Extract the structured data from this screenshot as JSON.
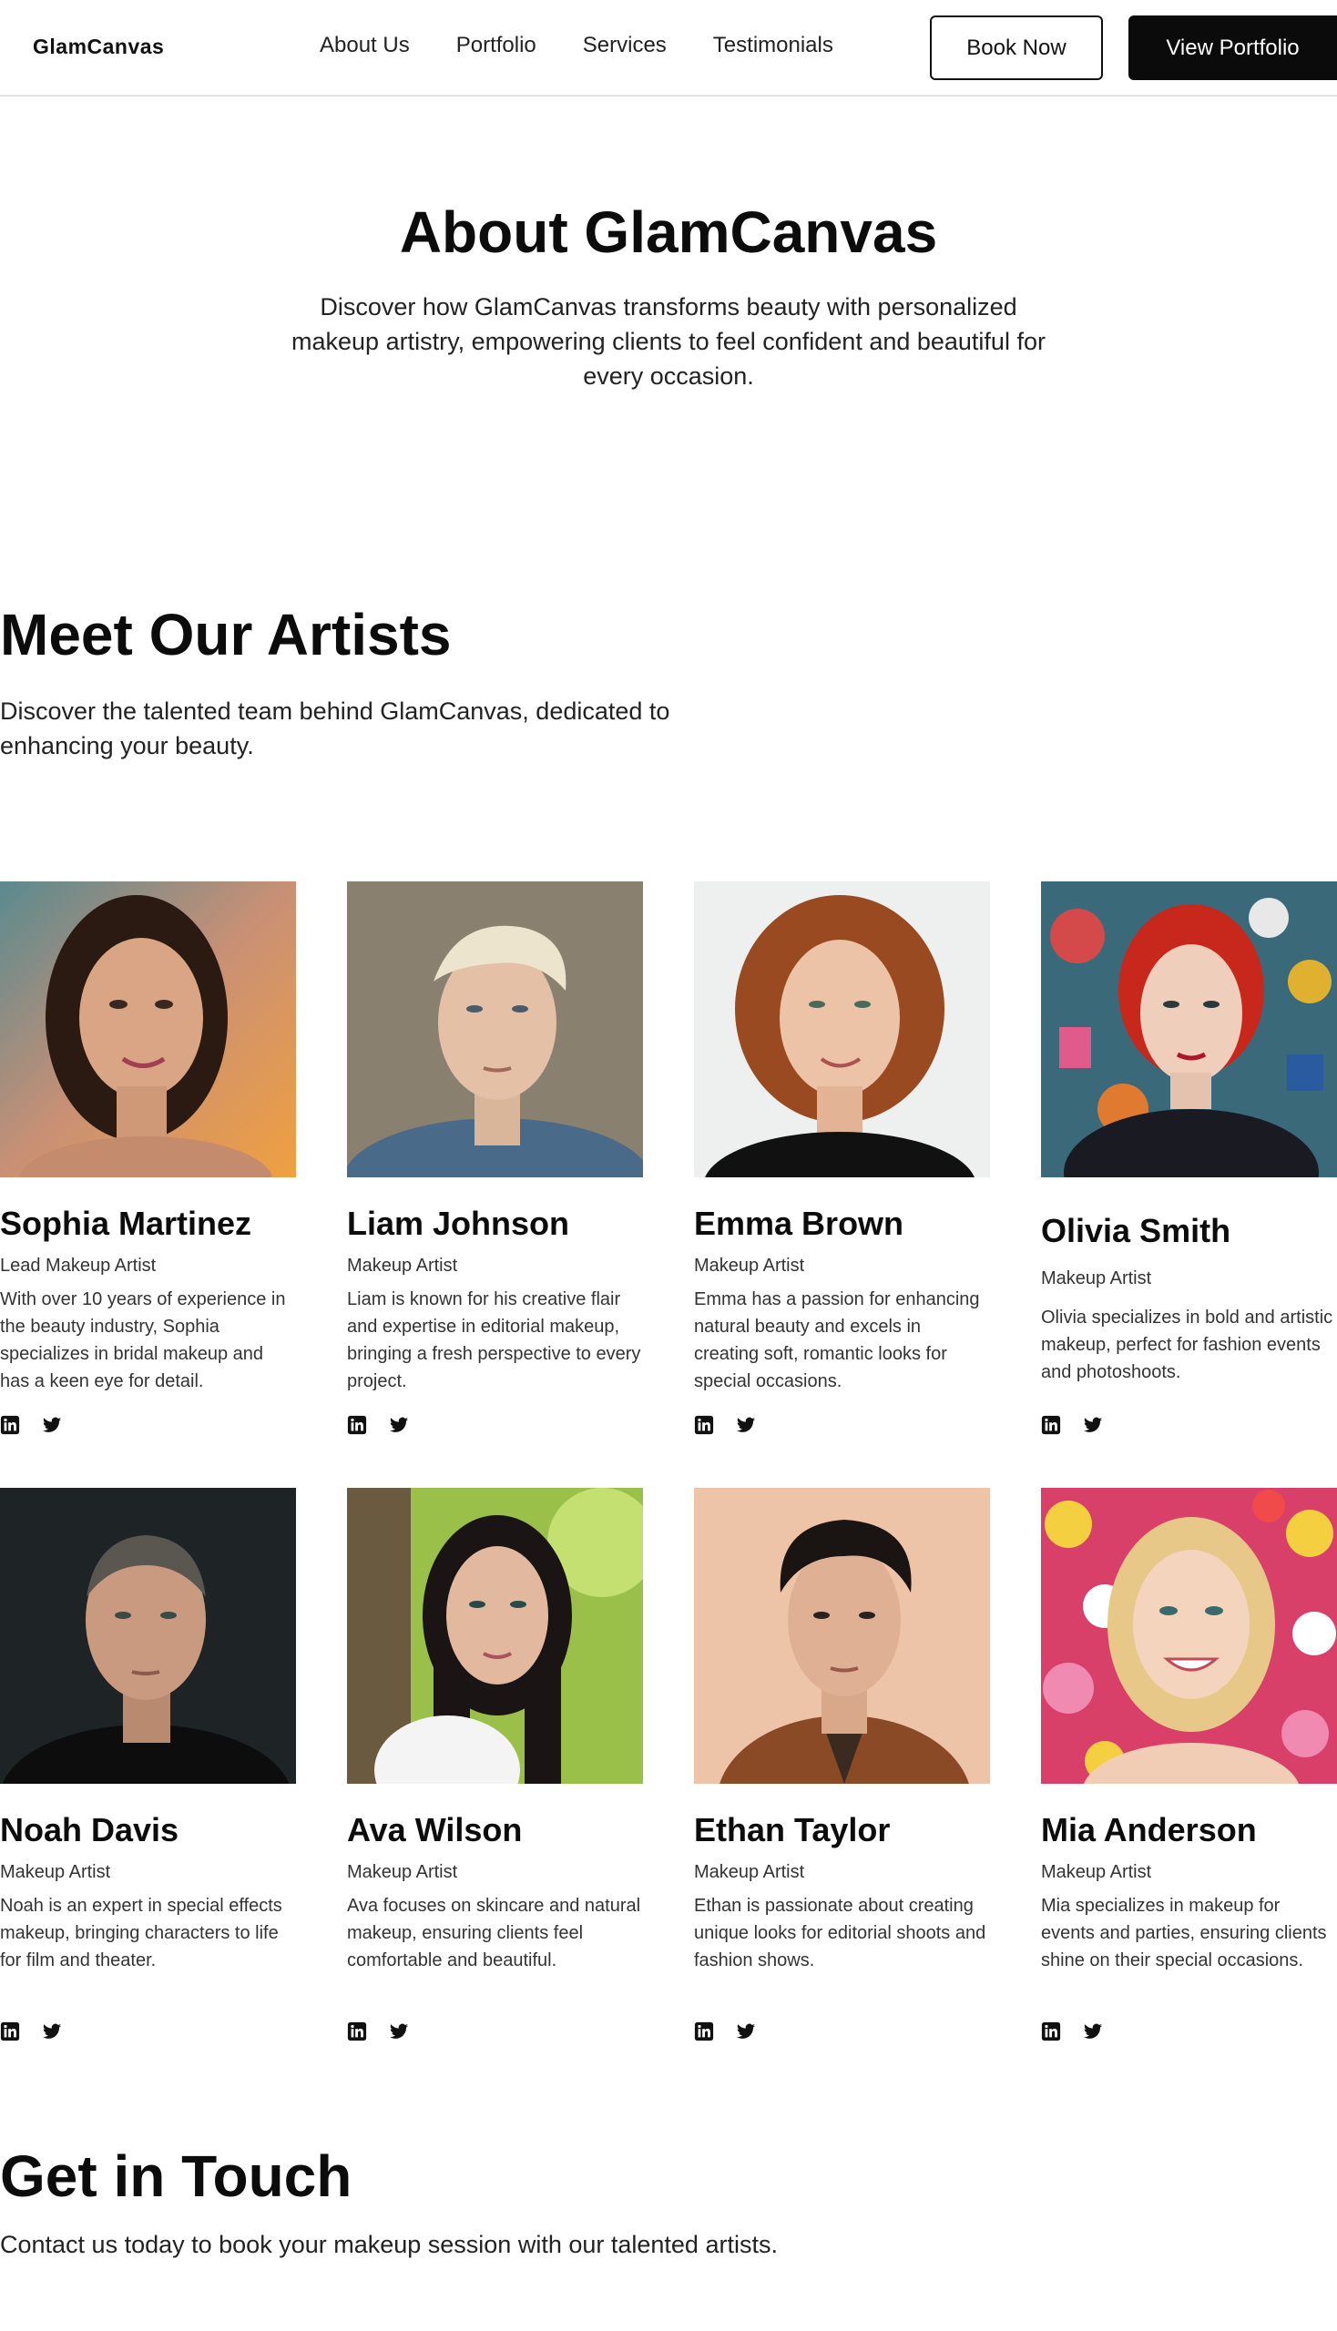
{
  "nav": {
    "logo": "GlamCanvas",
    "links": [
      "About Us",
      "Portfolio",
      "Services",
      "Testimonials"
    ],
    "book_label": "Book Now",
    "portfolio_label": "View Portfolio"
  },
  "hero": {
    "title": "About GlamCanvas",
    "subtitle": "Discover how GlamCanvas transforms beauty with personalized makeup artistry, empowering clients to feel confident and beautiful for every occasion."
  },
  "artists_section": {
    "title": "Meet Our Artists",
    "subtitle": "Discover the talented team behind GlamCanvas, dedicated to enhancing your beauty."
  },
  "artists": [
    {
      "name": "Sophia Martinez",
      "role": "Lead Makeup Artist",
      "bio": "With over 10 years of experience in the beauty industry, Sophia specializes in bridal makeup and has a keen eye for detail."
    },
    {
      "name": "Liam Johnson",
      "role": "Makeup Artist",
      "bio": "Liam is known for his creative flair and expertise in editorial makeup, bringing a fresh perspective to every project."
    },
    {
      "name": "Emma Brown",
      "role": "Makeup Artist",
      "bio": "Emma has a passion for enhancing natural beauty and excels in creating soft, romantic looks for special occasions."
    },
    {
      "name": "Olivia Smith",
      "role": "Makeup Artist",
      "bio": "Olivia specializes in bold and artistic makeup, perfect for fashion events and photoshoots."
    },
    {
      "name": "Noah Davis",
      "role": "Makeup Artist",
      "bio": "Noah is an expert in special effects makeup, bringing characters to life for film and theater."
    },
    {
      "name": "Ava Wilson",
      "role": "Makeup Artist",
      "bio": "Ava focuses on skincare and natural makeup, ensuring clients feel comfortable and beautiful."
    },
    {
      "name": "Ethan Taylor",
      "role": "Makeup Artist",
      "bio": "Ethan is passionate about creating unique looks for editorial shoots and fashion shows."
    },
    {
      "name": "Mia Anderson",
      "role": "Makeup Artist",
      "bio": "Mia specializes in makeup for events and parties, ensuring clients shine on their special occasions."
    }
  ],
  "icons": {
    "social_1": "linkedin-icon",
    "social_2": "twitter-icon"
  },
  "contact": {
    "title": "Get in Touch",
    "subtitle": "Contact us today to book your makeup session with our talented artists."
  }
}
